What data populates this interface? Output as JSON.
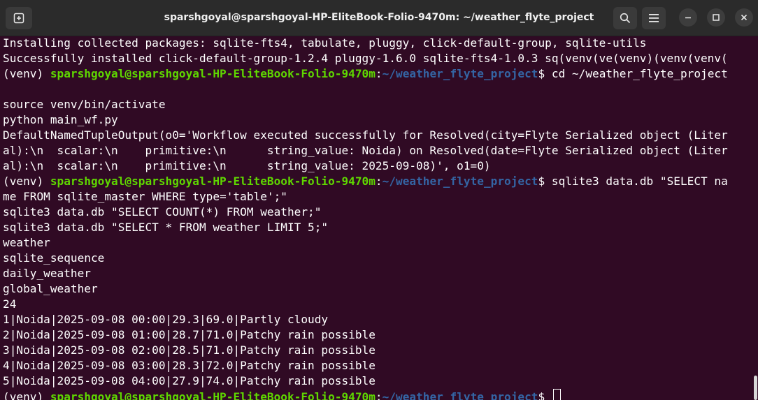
{
  "window": {
    "title": "sparshgoyal@sparshgoyal-HP-EliteBook-Folio-9470m: ~/weather_flyte_project"
  },
  "toolbar": {
    "new_tab_icon": "new-tab-icon",
    "search_icon": "search-icon",
    "menu_icon": "hamburger-menu-icon",
    "minimize_icon": "minimize-icon",
    "maximize_icon": "maximize-icon",
    "close_icon": "close-icon"
  },
  "prompt": {
    "venv": "(venv) ",
    "user_host": "sparshgoyal@sparshgoyal-HP-EliteBook-Folio-9470m",
    "colon": ":",
    "path": "~/weather_flyte_project",
    "dollar": "$ "
  },
  "colors": {
    "background": "#300a24",
    "prompt_user": "#5fd700",
    "prompt_path": "#3465a4"
  },
  "terminal": {
    "lines": [
      "Installing collected packages: sqlite-fts4, tabulate, pluggy, click-default-group, sqlite-utils",
      "Successfully installed click-default-group-1.2.4 pluggy-1.6.0 sqlite-fts4-1.0.3 sq(venv(ve(venv)(venv(venv(",
      "cd ~/weather_flyte_project",
      "",
      "source venv/bin/activate",
      "python main_wf.py",
      "DefaultNamedTupleOutput(o0='Workflow executed successfully for Resolved(city=Flyte Serialized object (Liter",
      "al):\\n  scalar:\\n    primitive:\\n      string_value: Noida) on Resolved(date=Flyte Serialized object (Liter",
      "al):\\n  scalar:\\n    primitive:\\n      string_value: 2025-09-08)', o1=0)",
      "sqlite3 data.db \"SELECT na",
      "me FROM sqlite_master WHERE type='table';\"",
      "sqlite3 data.db \"SELECT COUNT(*) FROM weather;\"",
      "sqlite3 data.db \"SELECT * FROM weather LIMIT 5;\"",
      "weather",
      "sqlite_sequence",
      "daily_weather",
      "global_weather",
      "24",
      "1|Noida|2025-09-08 00:00|29.3|69.0|Partly cloudy",
      "2|Noida|2025-09-08 01:00|28.7|71.0|Patchy rain possible",
      "3|Noida|2025-09-08 02:00|28.5|71.0|Patchy rain possible",
      "4|Noida|2025-09-08 03:00|28.3|72.0|Patchy rain possible",
      "5|Noida|2025-09-08 04:00|27.9|74.0|Patchy rain possible"
    ]
  }
}
